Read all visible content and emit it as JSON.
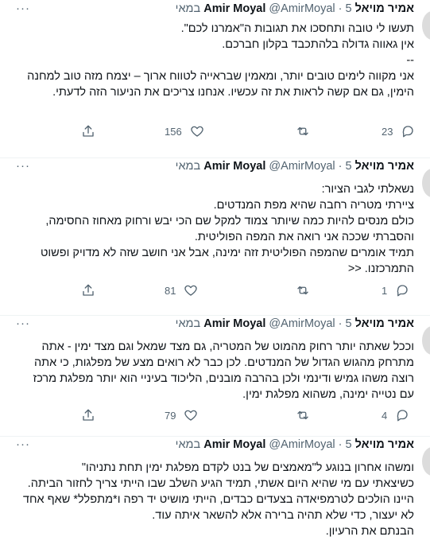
{
  "tweets": [
    {
      "name": "אמיר מויאל Amir Moyal",
      "handle": "@AmirMoyal",
      "separator": "·",
      "time": "5 במאי",
      "more": "···",
      "text": "תעשו לי טובה ותחסכו את תגובות ה\"אמרנו לכם\".\nאין גאווה גדולה בלהתכבד בקלון חברכם.\n--\nאני מקווה לימים טובים יותר, ומאמין שבראייה לטווח ארוך – יצמח מזה טוב למחנה הימין, גם אם קשה לראות את זה עכשיו. אנחנו צריכים את הניעור הזה לדעתי.",
      "likes": "156",
      "retweets": "",
      "replies": "23"
    },
    {
      "name": "אמיר מויאל Amir Moyal",
      "handle": "@AmirMoyal",
      "separator": "·",
      "time": "5 במאי",
      "more": "···",
      "text": "נשאלתי לגבי הציור:\nציירתי מטריה רחבה שהיא מפת המנדטים.\nכולם מנסים להיות כמה שיותר צמוד למקל שם הכי יבש ורחוק מאחוז החסימה, והסברתי שככה אני רואה את המפה הפוליטית.\nתמיד אומרים שהמפה הפוליטית זזה ימינה, אבל אני חושב שזה לא מדויק ופשוט התמרכזנו. <<",
      "likes": "81",
      "retweets": "",
      "replies": "1"
    },
    {
      "name": "אמיר מויאל Amir Moyal",
      "handle": "@AmirMoyal",
      "separator": "·",
      "time": "5 במאי",
      "more": "···",
      "text": "וככל שאתה יותר רחוק מהמוט של המטריה, גם מצד שמאל וגם מצד ימין - אתה מתרחק מהגוש הגדול של המנדטים. לכן כבר לא רואים מצע של מפלגות, כי אתה רוצה משהו גמיש ודינמי ולכן בהרבה מובנים, הליכוד בעיניי הוא יותר מפלגת מרכז עם נטייה ימינה, משהוא מפלגת ימין.",
      "likes": "79",
      "retweets": "",
      "replies": "4"
    },
    {
      "name": "אמיר מויאל Amir Moyal",
      "handle": "@AmirMoyal",
      "separator": "·",
      "time": "5 במאי",
      "more": "···",
      "text": "ומשהו אחרון בנוגע ל\"מאמצים של בנט לקדם מפלגת ימין תחת נתניהו\"\nכשיצאתי עם מי שהיא היום אשתי, תמיד הגיע השלב שבו הייתי צריך לחזור הביתה.\nהיינו הולכים לטרמפיאדה בצעדים כבדים, הייתי מושיט יד רפה ו*מתפלל* שאף אחד לא יעצור, כדי שלא תהיה ברירה אלא להשאר איתה עוד.\nהבנתם את הרעיון.",
      "likes": "",
      "retweets": "",
      "replies": ""
    }
  ],
  "colors": {
    "text": "#0f1419",
    "secondary": "#536471",
    "divider": "#eff3f4"
  },
  "icons": {
    "share": "share-icon",
    "like": "heart-icon",
    "retweet": "retweet-icon",
    "reply": "reply-icon"
  }
}
